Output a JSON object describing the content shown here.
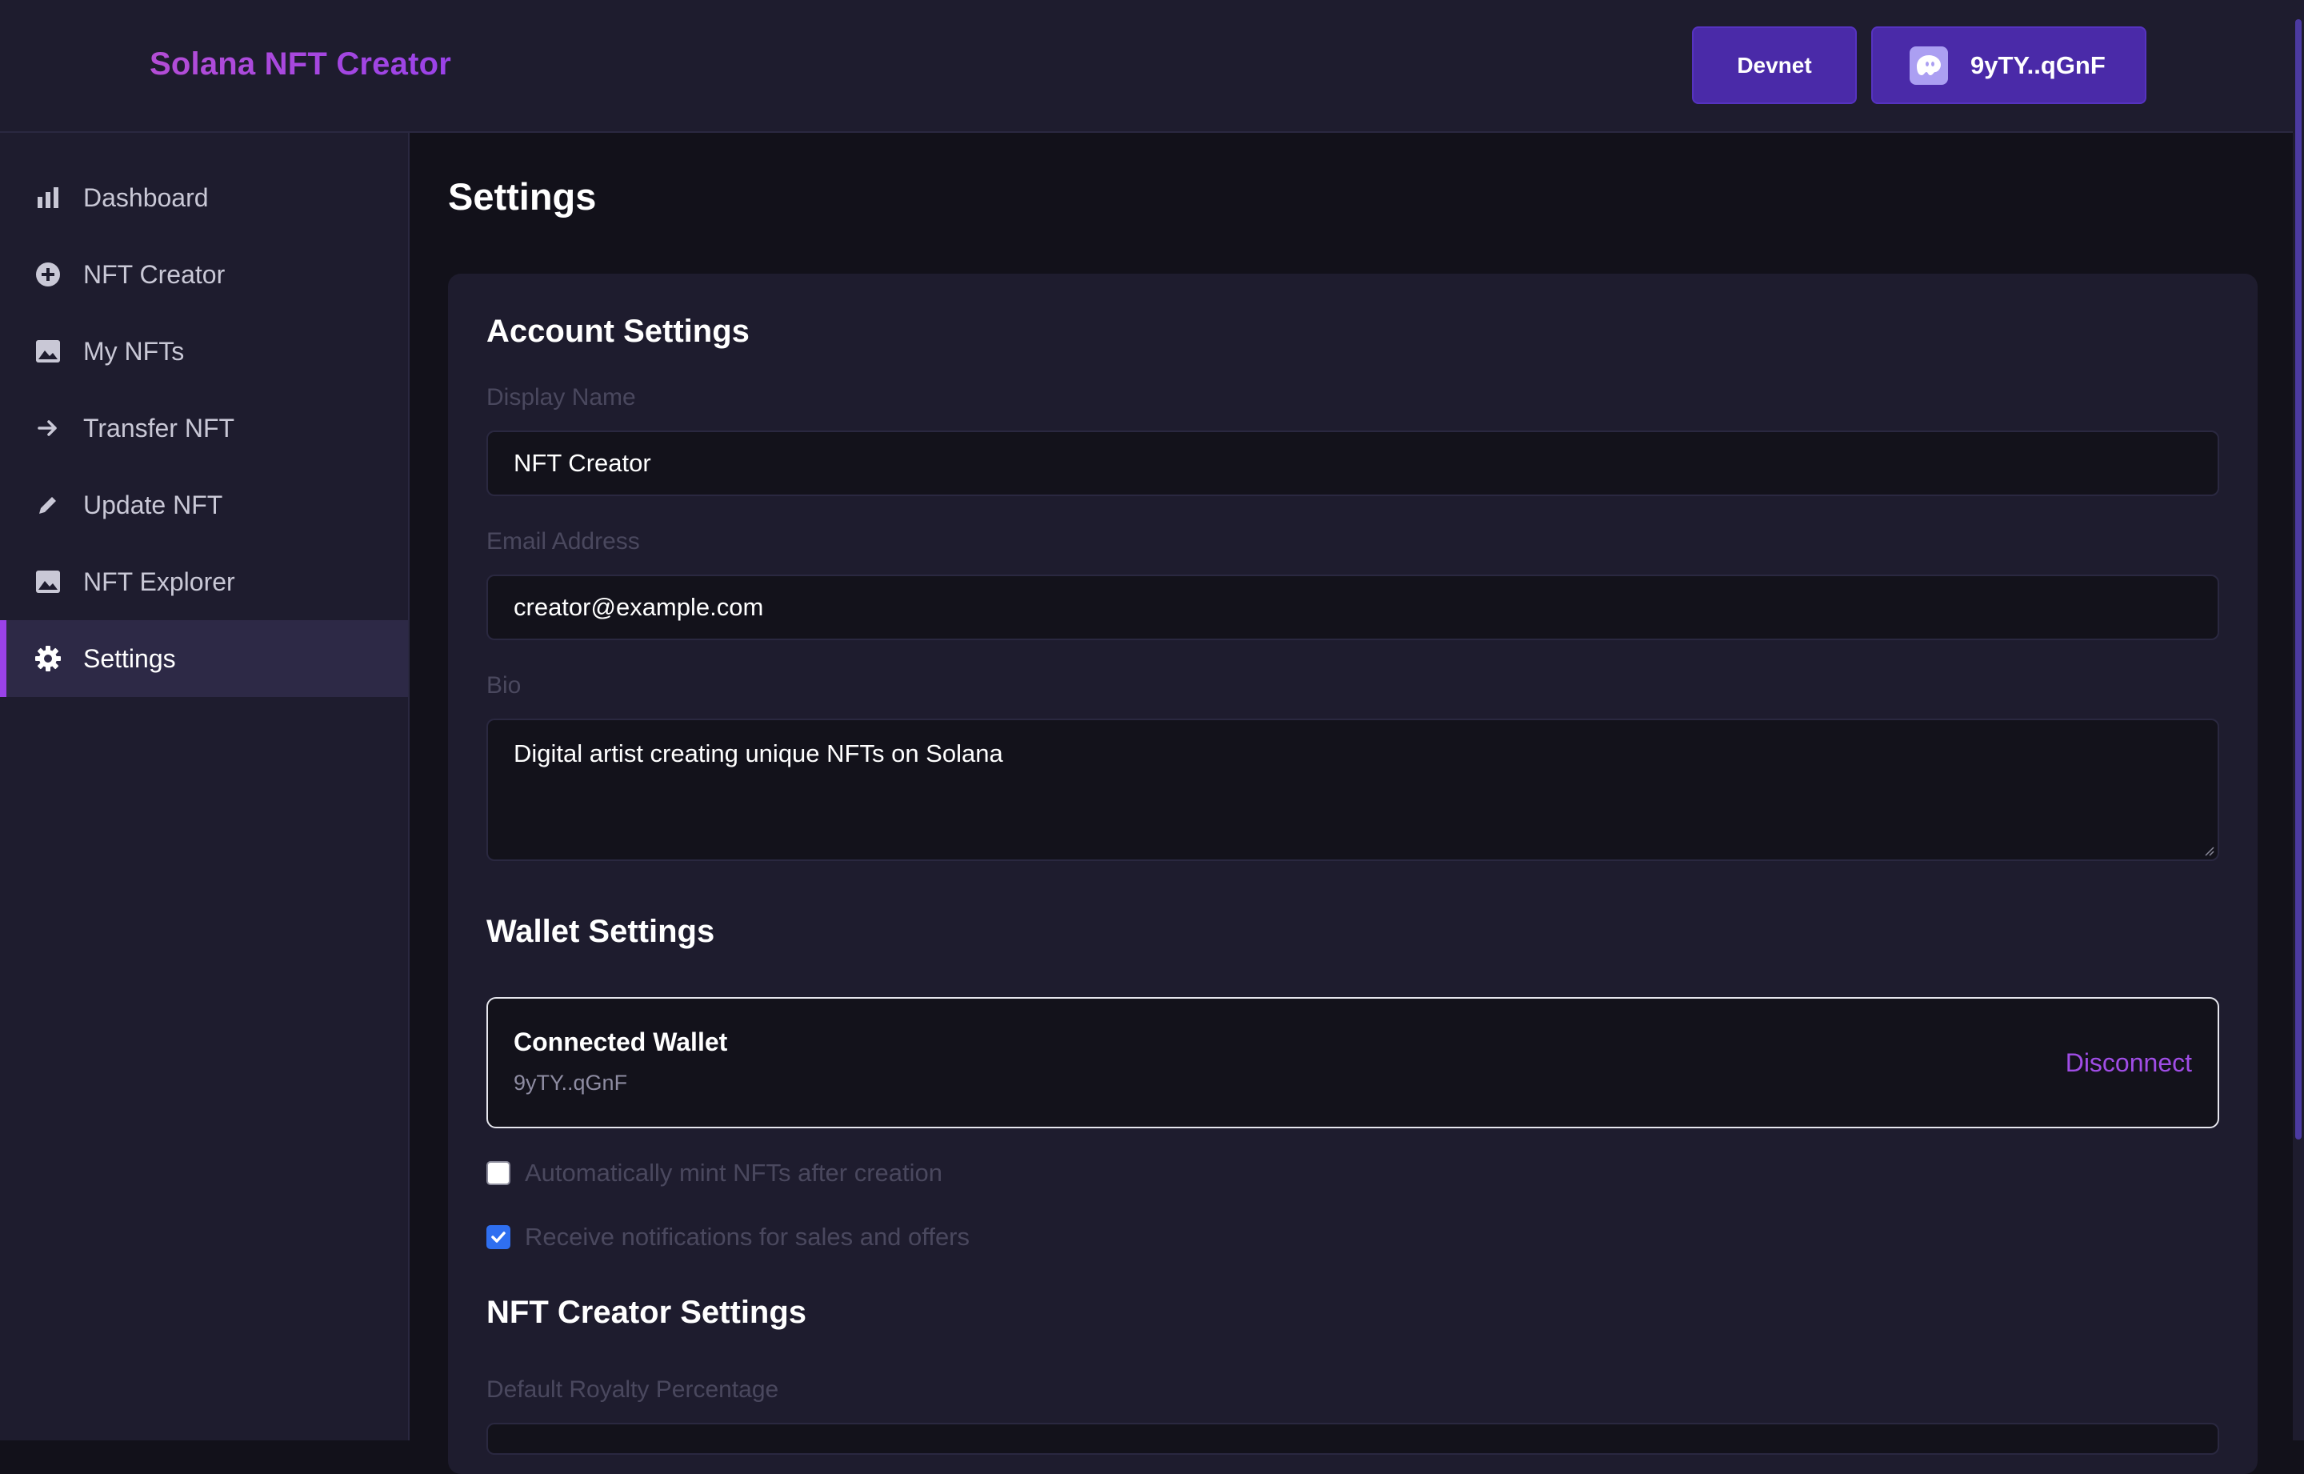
{
  "header": {
    "brand": "Solana NFT Creator",
    "network_label": "Devnet",
    "wallet_label": "9yTY..qGnF"
  },
  "sidebar": {
    "items": [
      {
        "label": "Dashboard",
        "icon": "bar-chart-icon"
      },
      {
        "label": "NFT Creator",
        "icon": "plus-circle-icon"
      },
      {
        "label": "My NFTs",
        "icon": "image-icon"
      },
      {
        "label": "Transfer NFT",
        "icon": "arrow-right-icon"
      },
      {
        "label": "Update NFT",
        "icon": "pencil-icon"
      },
      {
        "label": "NFT Explorer",
        "icon": "image-icon"
      },
      {
        "label": "Settings",
        "icon": "gear-icon",
        "active": true
      }
    ]
  },
  "main": {
    "title": "Settings",
    "account": {
      "heading": "Account Settings",
      "display_name_label": "Display Name",
      "display_name_value": "NFT Creator",
      "email_label": "Email Address",
      "email_value": "creator@example.com",
      "bio_label": "Bio",
      "bio_value": "Digital artist creating unique NFTs on Solana"
    },
    "wallet": {
      "heading": "Wallet Settings",
      "connected_title": "Connected Wallet",
      "address": "9yTY..qGnF",
      "disconnect_label": "Disconnect",
      "auto_mint_label": "Automatically mint NFTs after creation",
      "auto_mint_checked": false,
      "notifications_label": "Receive notifications for sales and offers",
      "notifications_checked": true
    },
    "creator": {
      "heading": "NFT Creator Settings",
      "royalty_label": "Default Royalty Percentage"
    }
  },
  "colors": {
    "accent": "#9a42e8",
    "button_bg": "#4a2aa8",
    "panel_bg": "#1e1c2e",
    "page_bg": "#12111a",
    "checkbox_checked": "#2f6ff0"
  }
}
